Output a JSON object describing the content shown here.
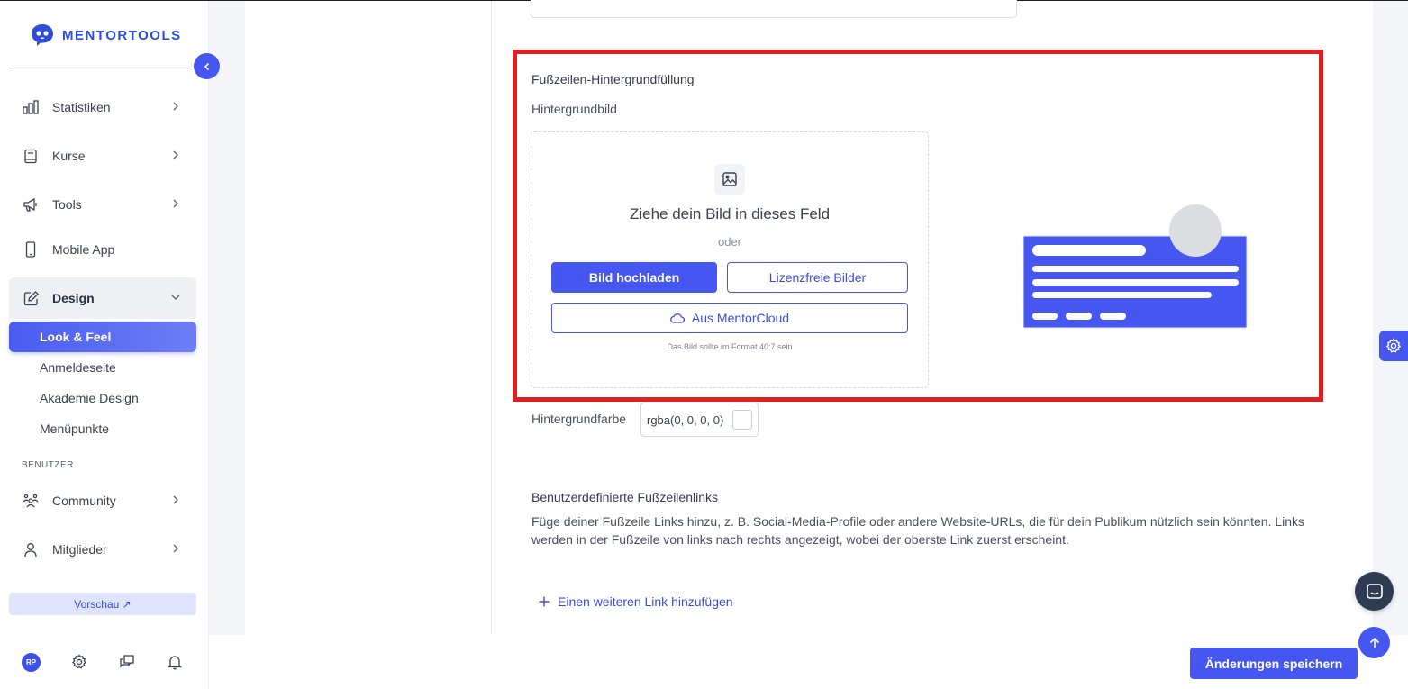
{
  "brand": {
    "name": "MENTORTOOLS",
    "accent": "#4557f0"
  },
  "sidebar": {
    "items": [
      {
        "label": "Statistiken",
        "icon": "bar-chart-icon"
      },
      {
        "label": "Kurse",
        "icon": "book-icon"
      },
      {
        "label": "Tools",
        "icon": "megaphone-icon"
      },
      {
        "label": "Mobile App",
        "icon": "mobile-icon"
      },
      {
        "label": "Design",
        "icon": "pencil-icon"
      }
    ],
    "design_sub": [
      {
        "label": "Look & Feel"
      },
      {
        "label": "Anmeldeseite"
      },
      {
        "label": "Akademie Design"
      },
      {
        "label": "Menüpunkte"
      }
    ],
    "section_users": "BENUTZER",
    "user_items": [
      {
        "label": "Community",
        "icon": "community-icon"
      },
      {
        "label": "Mitglieder",
        "icon": "user-icon"
      }
    ],
    "preview_label": "Vorschau ↗",
    "avatar_initials": "RP"
  },
  "footer_fill": {
    "title": "Fußzeilen-Hintergrundfüllung",
    "image_label": "Hintergrundbild",
    "drop_text": "Ziehe dein Bild in dieses Feld",
    "or_text": "oder",
    "upload_label": "Bild hochladen",
    "stock_label": "Lizenzfreie Bilder",
    "cloud_label": "Aus MentorCloud",
    "hint": "Das Bild sollte im Format 40:7 sein",
    "bg_color_label": "Hintergrundfarbe",
    "bg_color_value": "rgba(0, 0, 0, 0)"
  },
  "custom_links": {
    "title": "Benutzerdefinierte Fußzeilenlinks",
    "description": "Füge deiner Fußzeile Links hinzu, z. B. Social-Media-Profile oder andere Website-URLs, die für dein Publikum nützlich sein könnten. Links werden in der Fußzeile von links nach rechts angezeigt, wobei der oberste Link zuerst erscheint.",
    "add_label": "Einen weiteren Link hinzufügen"
  },
  "save_label": "Änderungen speichern"
}
